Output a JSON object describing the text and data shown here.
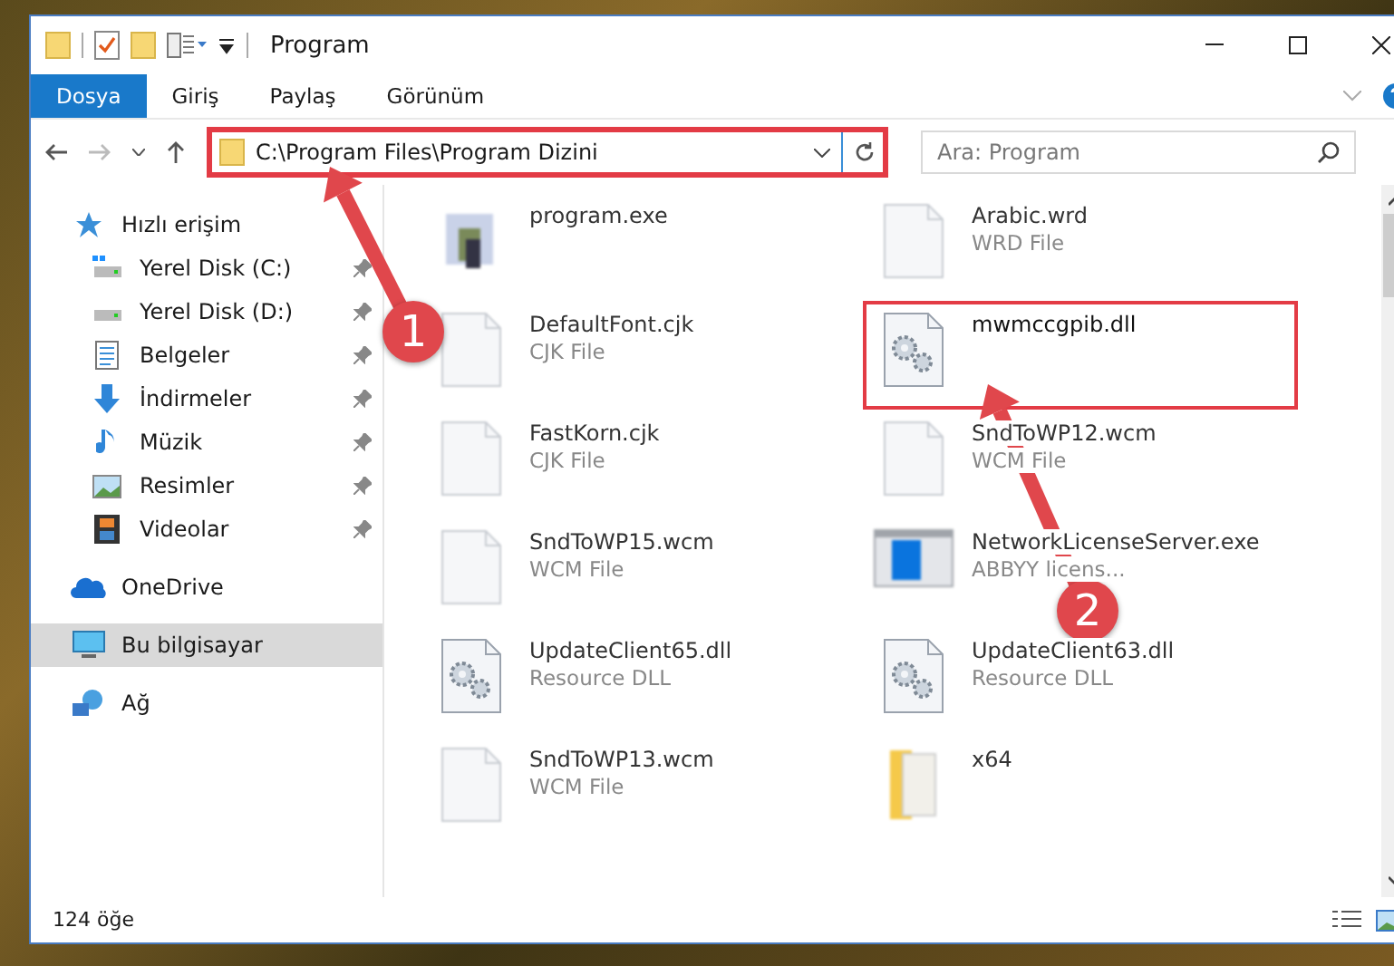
{
  "window": {
    "title": "Program"
  },
  "ribbon_tabs": [
    {
      "label": "Dosya",
      "selected": true
    },
    {
      "label": "Giriş",
      "selected": false
    },
    {
      "label": "Paylaş",
      "selected": false
    },
    {
      "label": "Görünüm",
      "selected": false
    }
  ],
  "address_bar": {
    "path": "C:\\Program Files\\Program Dizini",
    "highlighted": true
  },
  "search": {
    "placeholder": "Ara: Program"
  },
  "sidebar": {
    "items": [
      {
        "label": "Hızlı erişim",
        "kind": "star",
        "selected": false,
        "children": [
          {
            "label": "Yerel Disk (C:)",
            "kind": "drive-c",
            "selected": false,
            "pinned": true
          },
          {
            "label": "Yerel Disk (D:)",
            "kind": "drive",
            "selected": false,
            "pinned": true
          },
          {
            "label": "Belgeler",
            "kind": "documents",
            "selected": false,
            "pinned": true
          },
          {
            "label": "İndirmeler",
            "kind": "download",
            "selected": false,
            "pinned": true
          },
          {
            "label": "Müzik",
            "kind": "music",
            "selected": false,
            "pinned": true
          },
          {
            "label": "Resimler",
            "kind": "pictures",
            "selected": false,
            "pinned": true
          },
          {
            "label": "Videolar",
            "kind": "videos",
            "selected": false,
            "pinned": true
          }
        ]
      },
      {
        "label": "OneDrive",
        "kind": "cloud",
        "selected": false
      },
      {
        "label": "Bu bilgisayar",
        "kind": "computer",
        "selected": true
      },
      {
        "label": "Ağ",
        "kind": "network",
        "selected": false
      }
    ]
  },
  "files": [
    {
      "name": "program.exe",
      "kind": "exe",
      "highlighted": false
    },
    {
      "name": "Arabic.wrd",
      "type": "WRD File",
      "kind": "document",
      "highlighted": false
    },
    {
      "name": "DefaultFont.cjk",
      "type": "CJK File",
      "kind": "document",
      "highlighted": false
    },
    {
      "name": "mwmccgpib.dll",
      "kind": "dll",
      "highlighted": true
    },
    {
      "name": "FastKorn.cjk",
      "type": "CJK File",
      "kind": "document",
      "highlighted": false
    },
    {
      "name": "SndToWP12.wcm",
      "type": "WCM File",
      "kind": "document",
      "highlighted": false
    },
    {
      "name": "SndToWP15.wcm",
      "type": "WCM File",
      "kind": "document",
      "highlighted": false
    },
    {
      "name": "NetworkLicenseServer.exe",
      "type": "ABBYY licens...",
      "kind": "app",
      "highlighted": false
    },
    {
      "name": "UpdateClient65.dll",
      "type": "Resource DLL",
      "kind": "dll",
      "highlighted": false
    },
    {
      "name": "UpdateClient63.dll",
      "type": "Resource DLL",
      "kind": "dll",
      "highlighted": false
    },
    {
      "name": "SndToWP13.wcm",
      "type": "WCM File",
      "kind": "document",
      "highlighted": false
    },
    {
      "name": "x64",
      "kind": "folder",
      "highlighted": false
    }
  ],
  "status_bar": {
    "item_count": "124 öğe"
  },
  "annotations": [
    {
      "label": "1"
    },
    {
      "label": "2"
    }
  ]
}
